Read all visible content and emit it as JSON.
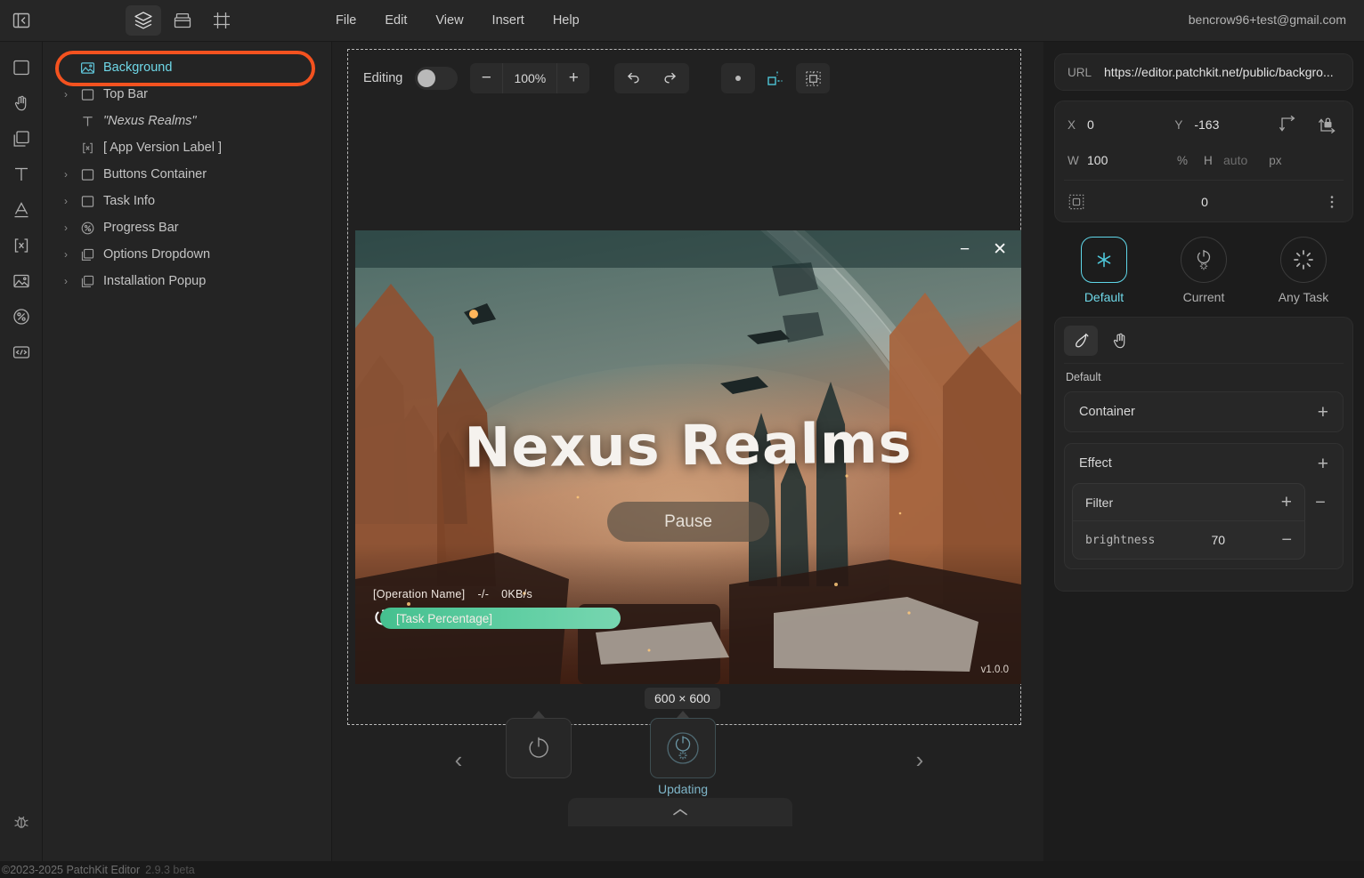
{
  "app": {
    "account_email": "bencrow96+test@gmail.com",
    "footer_copyright": "©2023-2025 PatchKit Editor",
    "footer_version": "2.9.3 beta"
  },
  "menubar": {
    "items": [
      {
        "label": "File"
      },
      {
        "label": "Edit"
      },
      {
        "label": "View"
      },
      {
        "label": "Insert"
      },
      {
        "label": "Help"
      }
    ]
  },
  "panel_tabs": [
    {
      "name": "layers-tab",
      "icon": "layers-icon",
      "active": true
    },
    {
      "name": "assets-tab",
      "icon": "folder-icon",
      "active": false
    },
    {
      "name": "artboard-tab",
      "icon": "frame-icon",
      "active": false
    }
  ],
  "tool_rail": [
    {
      "name": "rectangle-tool",
      "icon": "rectangle-icon"
    },
    {
      "name": "hand-tool",
      "icon": "hand-pointer-icon"
    },
    {
      "name": "group-tool",
      "icon": "stacked-squares-icon"
    },
    {
      "name": "text-tool",
      "icon": "text-t-icon"
    },
    {
      "name": "font-tool",
      "icon": "letter-a-icon"
    },
    {
      "name": "variable-tool",
      "icon": "bracket-x-icon"
    },
    {
      "name": "image-tool",
      "icon": "image-icon"
    },
    {
      "name": "progress-tool",
      "icon": "percent-circle-icon"
    },
    {
      "name": "code-tool",
      "icon": "code-brackets-icon"
    }
  ],
  "rail_bottom": {
    "name": "debug-tool",
    "icon": "bug-icon"
  },
  "layers": {
    "items": [
      {
        "label": "Background",
        "icon": "image-icon",
        "expandable": false,
        "selected": true,
        "italic": false,
        "highlighted": true
      },
      {
        "label": "Top Bar",
        "icon": "rectangle-icon",
        "expandable": true,
        "selected": false,
        "italic": false,
        "highlighted": false
      },
      {
        "label": "\"Nexus Realms\"",
        "icon": "text-t-icon",
        "expandable": false,
        "selected": false,
        "italic": true,
        "highlighted": false
      },
      {
        "label": "[ App Version Label ]",
        "icon": "bracket-x-icon",
        "expandable": false,
        "selected": false,
        "italic": false,
        "highlighted": false
      },
      {
        "label": "Buttons Container",
        "icon": "rectangle-icon",
        "expandable": true,
        "selected": false,
        "italic": false,
        "highlighted": false
      },
      {
        "label": "Task Info",
        "icon": "rectangle-icon",
        "expandable": true,
        "selected": false,
        "italic": false,
        "highlighted": false
      },
      {
        "label": "Progress Bar",
        "icon": "percent-circle-icon",
        "expandable": true,
        "selected": false,
        "italic": false,
        "highlighted": false
      },
      {
        "label": "Options Dropdown",
        "icon": "stacked-squares-icon",
        "expandable": true,
        "selected": false,
        "italic": false,
        "highlighted": false
      },
      {
        "label": "Installation Popup",
        "icon": "stacked-squares-icon",
        "expandable": true,
        "selected": false,
        "italic": false,
        "highlighted": false
      }
    ],
    "highlight_color": "#f4521f",
    "selected_color": "#6fd8e8"
  },
  "canvas_toolbar": {
    "editing_label": "Editing",
    "editing_enabled": false,
    "zoom_level": "100%",
    "zoom_out_label": "−",
    "zoom_in_label": "+",
    "undo_icon": "undo-arrow-icon",
    "redo_icon": "redo-arrow-icon",
    "snap_buttons": [
      {
        "name": "snap-point-button",
        "icon": "dot-icon",
        "active": false
      },
      {
        "name": "snap-object-button",
        "icon": "snap-object-icon",
        "active": true
      },
      {
        "name": "snap-grid-button",
        "icon": "snap-grid-icon",
        "active": false
      }
    ]
  },
  "preview": {
    "window_minimize": "−",
    "window_close": "✕",
    "game_title": "Nexus Realms",
    "pause_button": "Pause",
    "operation_name": "[Operation Name]",
    "operation_progress": "-/-",
    "operation_speed": "0KB/s",
    "task_percentage": "[Task Percentage]",
    "app_version": "v1.0.0",
    "progress_color": "#5ecb9f"
  },
  "pages": {
    "prev_label": "‹",
    "next_label": "›",
    "size_tooltip": "600 × 600",
    "items": [
      {
        "name": "page-thumb-restart",
        "icon": "restart-icon",
        "label": "",
        "selected": false
      },
      {
        "name": "page-thumb-updating",
        "icon": "updating-icon",
        "label": "Updating",
        "selected": true
      }
    ],
    "expand_icon": "chevron-up-icon"
  },
  "properties": {
    "url": {
      "key": "URL",
      "value": "https://editor.patchkit.net/public/backgro..."
    },
    "geometry": {
      "x_key": "X",
      "x_value": "0",
      "y_key": "Y",
      "y_value": "-163",
      "w_key": "W",
      "w_value": "100",
      "w_unit": "%",
      "h_key": "H",
      "h_value": "auto",
      "h_unit": "px",
      "corner_icon": "corner-radius-icon",
      "corner_value": "0",
      "more_icon": "more-vertical-icon",
      "wrap_icon": "wrap-arrow-icon",
      "lock_icon": "lock-aspect-icon"
    },
    "states": [
      {
        "label": "Default",
        "icon": "asterisk-icon",
        "selected": true
      },
      {
        "label": "Current",
        "icon": "refresh-dots-icon",
        "selected": false
      },
      {
        "label": "Any Task",
        "icon": "spinner-dots-icon",
        "selected": false
      }
    ],
    "style": {
      "modes": [
        {
          "name": "paint-mode-button",
          "icon": "brush-icon",
          "active": true
        },
        {
          "name": "interact-mode-button",
          "icon": "hand-pointer-icon",
          "active": false
        }
      ],
      "sub_label": "Default",
      "sections": [
        {
          "title": "Container",
          "add_label": "+"
        },
        {
          "title": "Effect",
          "add_label": "+"
        }
      ],
      "filter": {
        "title": "Filter",
        "add_label": "+",
        "remove_label": "−",
        "properties": [
          {
            "key": "brightness",
            "value": "70",
            "remove_label": "−"
          }
        ]
      }
    }
  }
}
